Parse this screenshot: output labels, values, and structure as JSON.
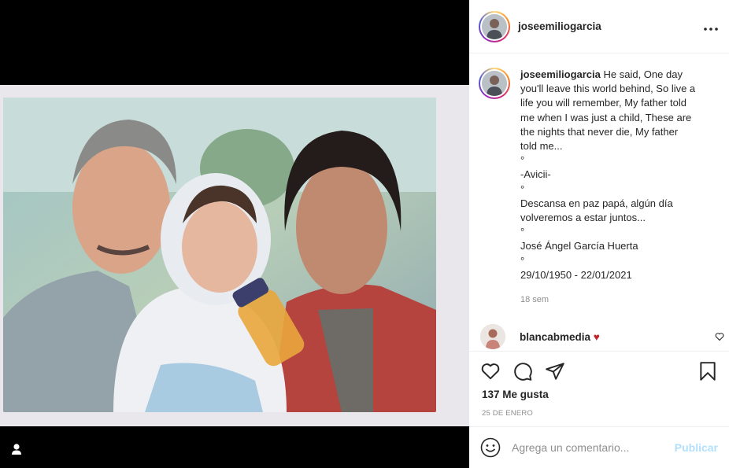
{
  "post": {
    "username": "joseemiliogarcia",
    "more_icon": "more-horizontal-icon",
    "caption": {
      "username": "joseemiliogarcia",
      "lines": [
        " He said, One day",
        "you'll leave this world behind, So live a",
        "life you will remember, My father told",
        "me when I was just a child, These are",
        "the nights that never die, My father",
        "told me...",
        "°",
        "-Avicii-",
        "°",
        "Descansa en paz papá, algún día",
        "volveremos a estar juntos...",
        "°",
        "José Ángel García Huerta",
        "°",
        "29/10/1950 - 22/01/2021"
      ],
      "time": "18 sem"
    },
    "comments": [
      {
        "username": "blancabmedia",
        "emoji": "♥"
      }
    ],
    "likes": "137 Me gusta",
    "date": "25 DE ENERO",
    "add_comment": {
      "placeholder": "Agrega un comentario...",
      "publish": "Publicar"
    },
    "colors": {
      "publish": "#b2dffc",
      "heart": "#c0262b",
      "muted": "#8e8e8e"
    }
  }
}
